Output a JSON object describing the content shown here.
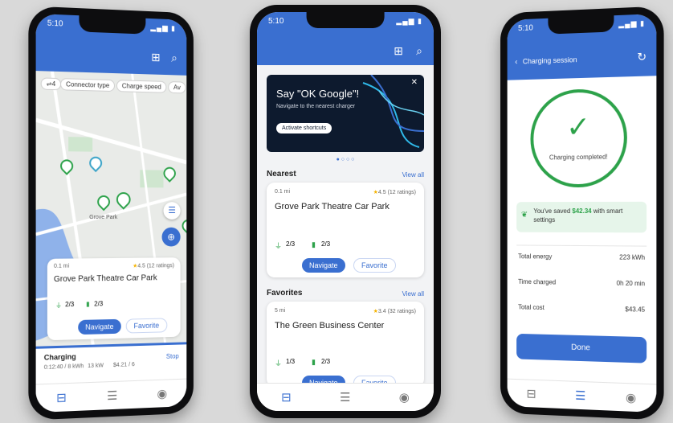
{
  "phone1": {
    "status_time": "5:10",
    "filters": [
      "Connector type",
      "Charge speed",
      "Av"
    ],
    "map_label": "Grove Park",
    "card": {
      "distance": "0.1 mi",
      "rating": "4.5 (12 ratings)",
      "title": "Grove Park Theatre Car Park",
      "stat1": "2/3",
      "stat2": "2/3",
      "navigate": "Navigate",
      "favorite": "Favorite"
    },
    "charging": {
      "title": "Charging",
      "detail1": "0:12:40 / 8 kWh",
      "detail2": "13 kW",
      "detail3": "$4.21 / 6",
      "stop": "Stop"
    }
  },
  "phone2": {
    "status_time": "5:10",
    "banner": {
      "title": "Say \"OK Google\"!",
      "subtitle": "Navigate to the nearest charger",
      "button": "Activate shortcuts"
    },
    "nearest": {
      "section_title": "Nearest",
      "view_all": "View all",
      "distance": "0.1 mi",
      "rating": "4.5 (12 ratings)",
      "title": "Grove Park Theatre Car Park",
      "stat1": "2/3",
      "stat2": "2/3",
      "navigate": "Navigate",
      "favorite": "Favorite"
    },
    "favorites": {
      "section_title": "Favorites",
      "view_all": "View all",
      "distance": "5 mi",
      "rating": "3.4 (32 ratings)",
      "title": "The Green Business Center",
      "stat1": "1/3",
      "stat2": "2/3",
      "navigate": "Navigate",
      "favorite": "Favorite"
    }
  },
  "phone3": {
    "status_time": "5:10",
    "header": "Charging session",
    "complete_label": "Charging completed!",
    "savings": {
      "prefix": "You've saved ",
      "amount": "$42.34",
      "suffix": " with smart settings"
    },
    "rows": [
      {
        "label": "Total energy",
        "value": "223 kWh"
      },
      {
        "label": "Time charged",
        "value": "0h 20 min"
      },
      {
        "label": "Total cost",
        "value": "$43.45"
      }
    ],
    "done": "Done"
  },
  "colors": {
    "accent": "#3a6fd0",
    "green": "#2da24a",
    "star": "#f5b301"
  },
  "icons": [
    "qr-code-icon",
    "search-icon",
    "location-crosshair-icon",
    "list-icon",
    "map-icon",
    "user-icon",
    "checkmark-icon",
    "refresh-icon",
    "back-arrow-icon",
    "close-icon",
    "star-icon",
    "plug-icon",
    "charger-icon"
  ]
}
